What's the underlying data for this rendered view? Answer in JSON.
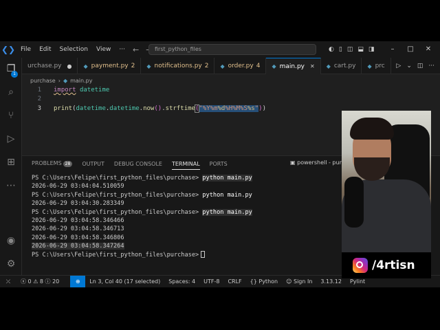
{
  "titlebar": {
    "menu": [
      "File",
      "Edit",
      "Selection",
      "View"
    ],
    "search_text": "first_python_files"
  },
  "activitybar": {
    "explorer_badge": "1"
  },
  "tabs": [
    {
      "label": "urchase.py",
      "count": "",
      "active": false,
      "modified": false
    },
    {
      "label": "payment.py",
      "count": "2",
      "active": false,
      "modified": true
    },
    {
      "label": "notifications.py",
      "count": "2",
      "active": false,
      "modified": true
    },
    {
      "label": "order.py",
      "count": "4",
      "active": false,
      "modified": true
    },
    {
      "label": "main.py",
      "count": "",
      "active": true,
      "modified": false
    },
    {
      "label": "cart.py",
      "count": "",
      "active": false,
      "modified": false
    },
    {
      "label": "prc",
      "count": "",
      "active": false,
      "modified": false
    }
  ],
  "breadcrumb": {
    "folder": "purchase",
    "file": "main.py"
  },
  "editor": {
    "line_numbers": [
      "1",
      "2",
      "3"
    ],
    "line1_kw": "import",
    "line1_mod": "datetime",
    "line3_fn": "print",
    "line3_mod1": "datetime",
    "line3_mod2": "datetime",
    "line3_now": "now",
    "line3_strf": "strftime",
    "line3_fmt": {
      "y": "%Y",
      "m": "%m",
      "d": "%d",
      "h": "%H",
      "mi": "%M",
      "s": "%S",
      "ms": "%s"
    }
  },
  "panel": {
    "tabs": [
      "PROBLEMS",
      "OUTPUT",
      "DEBUG CONSOLE",
      "TERMINAL",
      "PORTS"
    ],
    "problems_count": "28",
    "terminal_name": "powershell - purch",
    "prompt": "PS C:\\Users\\Felipe\\first_python_files\\purchase>",
    "command": "python main.py",
    "outputs": [
      "2026-06-29 03:04:04.510059",
      "2026-06-29 03:04:30.283349",
      "2026-06-29 03:04:58.346466",
      "2026-06-29 03:04:58.346713",
      "2026-06-29 03:04:58.346806",
      "2026-06-29 03:04:58.347264"
    ]
  },
  "statusbar": {
    "errors": "0",
    "warnings": "8",
    "info": "20",
    "position": "Ln 3, Col 40 (17 selected)",
    "spaces": "Spaces: 4",
    "encoding": "UTF-8",
    "eol": "CRLF",
    "language": "Python",
    "sign_in": "Sign In",
    "version": "3.13.12",
    "linter": "Pylint"
  },
  "overlay": {
    "handle": "/4rtisn"
  },
  "colors": {
    "accent": "#0078d4",
    "string": "#ce9178",
    "keyword": "#c586c0",
    "module": "#4ec9b0",
    "function": "#dcdcaa"
  }
}
